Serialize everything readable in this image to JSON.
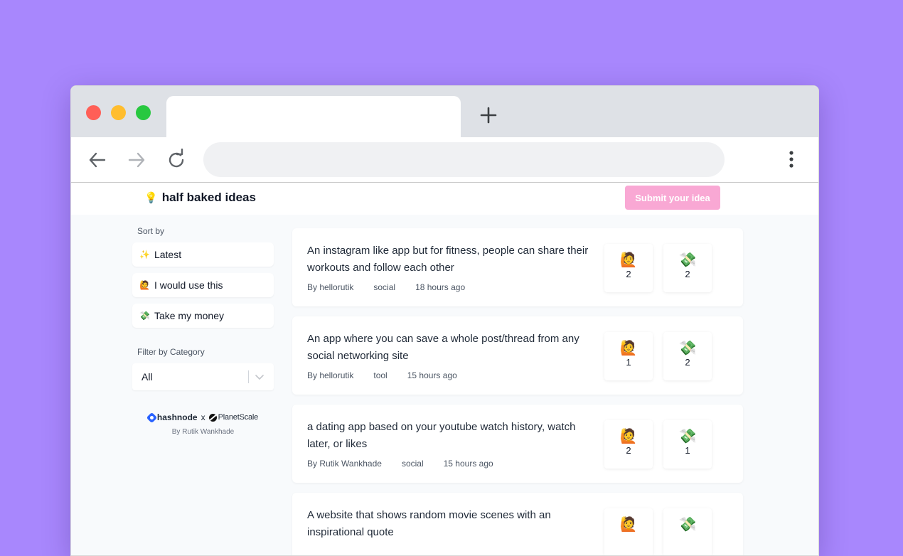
{
  "app": {
    "brand_emoji": "💡",
    "brand_name": "half baked ideas",
    "submit_label": "Submit your idea"
  },
  "sidebar": {
    "sort_label": "Sort by",
    "sort_items": [
      {
        "emoji": "✨",
        "label": "Latest"
      },
      {
        "emoji": "🙋",
        "label": "I would use this"
      },
      {
        "emoji": "💸",
        "label": "Take my money"
      }
    ],
    "filter_label": "Filter by Category",
    "filter_value": "All",
    "credits": {
      "hashnode": "hashnode",
      "separator": "x",
      "planetscale": "PlanetScale",
      "byline": "By Rutik Wankhade"
    }
  },
  "ideas": [
    {
      "title": "An instagram like app but for fitness, people can share their workouts and follow each other",
      "author": "By hellorutik",
      "category": "social",
      "time": "18 hours ago",
      "use_emoji": "🙋",
      "use_count": "2",
      "money_emoji": "💸",
      "money_count": "2"
    },
    {
      "title": "An app where you can save a whole post/thread from any social networking site",
      "author": "By hellorutik",
      "category": "tool",
      "time": "15 hours ago",
      "use_emoji": "🙋",
      "use_count": "1",
      "money_emoji": "💸",
      "money_count": "2"
    },
    {
      "title": "a dating app based on your youtube watch history, watch later, or likes",
      "author": "By Rutik Wankhade",
      "category": "social",
      "time": "15 hours ago",
      "use_emoji": "🙋",
      "use_count": "2",
      "money_emoji": "💸",
      "money_count": "1"
    },
    {
      "title": "A website that shows random movie scenes with an inspirational quote",
      "author": "",
      "category": "",
      "time": "",
      "use_emoji": "🙋",
      "use_count": "",
      "money_emoji": "💸",
      "money_count": ""
    }
  ],
  "colors": {
    "background": "#a887fd",
    "submit_button": "#f9a8d4",
    "page_bg": "#f8fafc"
  },
  "icons": [
    "back-arrow-icon",
    "forward-arrow-icon",
    "reload-icon",
    "new-tab-icon",
    "kebab-menu-icon",
    "chevron-down-icon"
  ]
}
